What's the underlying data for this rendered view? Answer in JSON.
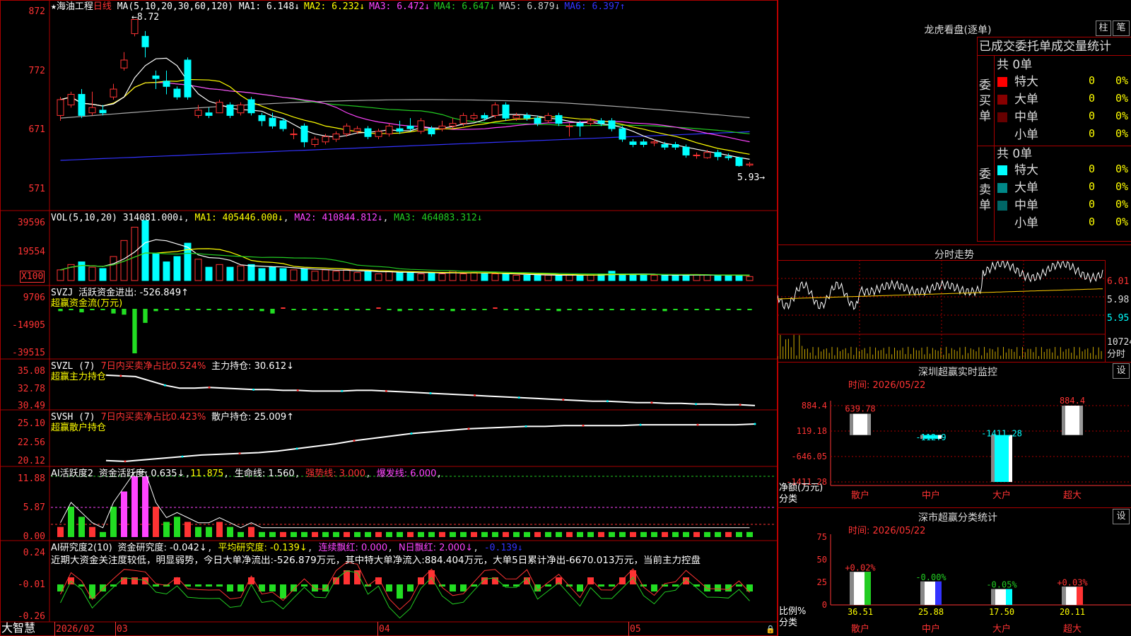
{
  "colors": {
    "up": "#ff3333",
    "down": "#00ffff",
    "grid": "#aa0000",
    "white": "#ffffff",
    "yellow": "#ffff00",
    "magenta": "#ff44ff",
    "green": "#22cc22",
    "gray": "#aaaaaa",
    "blue": "#3333ff",
    "gold": "#ffcc00"
  },
  "app": {
    "logo": "大智慧",
    "stock_name": "海油工程",
    "period": "日线",
    "star": "★"
  },
  "price_panel": {
    "ma_title": "MA(5,10,20,30,60,120)",
    "ma": [
      {
        "label": "MA1: 6.148↓",
        "color": "#ffffff"
      },
      {
        "label": "MA2: 6.232↓",
        "color": "#ffff00"
      },
      {
        "label": "MA3: 6.472↓",
        "color": "#ff44ff"
      },
      {
        "label": "MA4: 6.647↓",
        "color": "#22cc22"
      },
      {
        "label": "MA5: 6.879↓",
        "color": "#cccccc"
      },
      {
        "label": "MA6: 6.397↑",
        "color": "#3333ff"
      }
    ],
    "yticks": [
      "872",
      "772",
      "671",
      "571"
    ],
    "high_mark": "8.72",
    "low_mark": "5.93→"
  },
  "vol_panel": {
    "title": "VOL(5,10,20)",
    "value": "314081.000↓",
    "ma1": "MA1: 405446.000↓",
    "ma2": "MA2: 410844.812↓",
    "ma3": "MA3: 464083.312↓",
    "yticks": [
      "39596",
      "19554"
    ],
    "unit": "X100"
  },
  "svzj_panel": {
    "title": "SVZJ",
    "label": "活跃资金进出: -526.849↑",
    "subtitle": "超赢资金流(万元)",
    "yticks": [
      "9706",
      "-14905",
      "-39515"
    ]
  },
  "svzl_panel": {
    "title": "SVZL (7)",
    "net": "7日内买卖净占比0.524%",
    "hold": "主力持仓: 30.612↓",
    "subtitle": "超赢主力持仓",
    "yticks": [
      "35.08",
      "32.78",
      "30.49"
    ]
  },
  "svsh_panel": {
    "title": "SVSH (7)",
    "net": "7日内买卖净占比0.423%",
    "hold": "散户持仓: 25.009↑",
    "subtitle": "超赢散户持仓",
    "yticks": [
      "25.10",
      "22.56",
      "20.12"
    ]
  },
  "ai_active_panel": {
    "title": "AI活跃度2",
    "a": "资金活跃度: 0.635↓",
    "b": "11.875",
    "c": "生命线: 1.560",
    "d": "强势线: 3.000",
    "e": "爆发线: 6.000",
    "yticks": [
      "11.88",
      "5.87",
      "0.00"
    ]
  },
  "ai_research_panel": {
    "title": "AI研究度2(10)",
    "a": "资金研究度: -0.042↓",
    "b": "平均研究度: -0.139↓",
    "c": "连续飘红: 0.000",
    "d": "N日飘红: 2.000↓",
    "e": "-0.139↓",
    "comment": "近期大资金关注度较低，明显弱势，今日大单净流出:-526.879万元，其中特大单净流入:884.404万元，大单5日累计净出-6670.013万元，当前主力控盘",
    "yticks": [
      "0.24",
      "-0.01",
      "-0.26"
    ]
  },
  "date_axis": {
    "labels": [
      "2026/02",
      "03",
      "04",
      "05"
    ]
  },
  "lhb": {
    "title": "龙虎看盘(逐单)",
    "btn_zhu": "柱",
    "btn_bi": "笔",
    "header": "已成交委托单成交量统计",
    "buy_label": "委买单",
    "sell_label": "委卖单",
    "buy_total": "共 0单",
    "sell_total": "共 0单",
    "buy_rows": [
      {
        "name": "特大",
        "count": "0",
        "pct": "0%",
        "color": "#ff0000"
      },
      {
        "name": "大单",
        "count": "0",
        "pct": "0%",
        "color": "#880000"
      },
      {
        "name": "中单",
        "count": "0",
        "pct": "0%",
        "color": "#660000"
      },
      {
        "name": "小单",
        "count": "0",
        "pct": "0%",
        "color": ""
      }
    ],
    "sell_rows": [
      {
        "name": "特大",
        "count": "0",
        "pct": "0%",
        "color": "#00ffff"
      },
      {
        "name": "大单",
        "count": "0",
        "pct": "0%",
        "color": "#008888"
      },
      {
        "name": "中单",
        "count": "0",
        "pct": "0%",
        "color": "#006666"
      },
      {
        "name": "小单",
        "count": "0",
        "pct": "0%",
        "color": ""
      }
    ]
  },
  "intraday": {
    "title": "分时走势",
    "yticks": [
      "6.01",
      "5.98",
      "5.95"
    ],
    "vol_label": "10724",
    "vol_unit": "分时"
  },
  "sz_monitor": {
    "title": "深圳超赢实时监控",
    "btn": "设",
    "time": "时间: 2026/05/22",
    "yticks": [
      "884.4",
      "119.18",
      "-646.05",
      "-1411.28"
    ],
    "axis_label": "净额(万元)",
    "cat_label": "分类",
    "categories": [
      "散户",
      "中户",
      "大户",
      "超大"
    ],
    "values": [
      639.78,
      -112.9,
      -1411.28,
      884.4
    ],
    "value_labels": [
      "639.78",
      "-112.9",
      "-1411.28",
      "884.4"
    ]
  },
  "sz_class": {
    "title": "深市超赢分类统计",
    "btn": "设",
    "time": "时间: 2026/05/22",
    "yticks": [
      "75",
      "50",
      "25",
      "0"
    ],
    "axis_label": "比例%",
    "cat_label": "分类",
    "categories": [
      "散户",
      "中户",
      "大户",
      "超大"
    ],
    "values": [
      36.51,
      25.88,
      17.5,
      20.11
    ],
    "value_labels": [
      "36.51",
      "25.88",
      "17.50",
      "20.11"
    ],
    "change_labels": [
      "+0.02%",
      "-0.00%",
      "-0.05%",
      "+0.03%"
    ]
  },
  "chart_data": [
    {
      "type": "candlestick",
      "title": "海油工程 日线",
      "ylim": [
        5.5,
        8.9
      ],
      "candles": [
        [
          6.9,
          7.2,
          6.8,
          7.25
        ],
        [
          7.1,
          7.3,
          7.05,
          7.35
        ],
        [
          7.3,
          6.9,
          6.85,
          7.4
        ],
        [
          6.95,
          7.05,
          6.9,
          7.35
        ],
        [
          7.0,
          6.95,
          6.9,
          7.1
        ],
        [
          7.25,
          7.4,
          7.2,
          7.5
        ],
        [
          7.8,
          7.95,
          7.75,
          8.1
        ],
        [
          8.45,
          8.72,
          8.4,
          8.72
        ],
        [
          8.4,
          8.2,
          8.0,
          8.5
        ],
        [
          7.65,
          7.6,
          7.4,
          7.75
        ],
        [
          7.55,
          7.45,
          7.3,
          7.75
        ],
        [
          7.4,
          7.25,
          7.2,
          7.45
        ],
        [
          7.95,
          7.25,
          7.2,
          8.0
        ],
        [
          6.9,
          7.0,
          6.85,
          7.1
        ],
        [
          6.95,
          6.9,
          6.85,
          7.05
        ],
        [
          6.95,
          7.15,
          6.95,
          7.2
        ],
        [
          7.1,
          6.9,
          6.85,
          7.15
        ],
        [
          6.95,
          7.1,
          6.9,
          7.15
        ],
        [
          7.2,
          6.95,
          6.9,
          7.25
        ],
        [
          6.9,
          6.8,
          6.7,
          6.95
        ],
        [
          6.85,
          6.7,
          6.65,
          6.95
        ],
        [
          6.8,
          6.65,
          6.6,
          6.85
        ],
        [
          6.55,
          6.55,
          6.45,
          6.65
        ],
        [
          6.7,
          6.4,
          6.3,
          6.75
        ],
        [
          6.35,
          6.45,
          6.3,
          6.5
        ],
        [
          6.4,
          6.5,
          6.35,
          6.55
        ],
        [
          6.45,
          6.55,
          6.4,
          6.6
        ],
        [
          6.55,
          6.7,
          6.5,
          6.75
        ],
        [
          6.6,
          6.65,
          6.55,
          6.7
        ],
        [
          6.65,
          6.5,
          6.45,
          6.7
        ],
        [
          6.5,
          6.6,
          6.45,
          6.65
        ],
        [
          6.55,
          6.7,
          6.5,
          6.75
        ],
        [
          6.65,
          6.6,
          6.55,
          6.8
        ],
        [
          6.7,
          6.65,
          6.6,
          6.85
        ],
        [
          6.6,
          6.8,
          6.55,
          6.85
        ],
        [
          6.65,
          6.55,
          6.5,
          6.7
        ],
        [
          6.65,
          6.7,
          6.6,
          6.8
        ],
        [
          6.7,
          6.75,
          6.65,
          6.85
        ],
        [
          6.75,
          6.9,
          6.7,
          6.95
        ],
        [
          6.85,
          6.9,
          6.8,
          6.95
        ],
        [
          6.9,
          6.85,
          6.8,
          6.95
        ],
        [
          6.9,
          7.1,
          6.85,
          7.15
        ],
        [
          7.1,
          6.85,
          6.8,
          7.15
        ],
        [
          6.85,
          6.9,
          6.8,
          6.95
        ],
        [
          6.9,
          6.85,
          6.8,
          6.95
        ],
        [
          6.85,
          6.75,
          6.7,
          6.9
        ],
        [
          6.8,
          6.9,
          6.75,
          6.95
        ],
        [
          6.9,
          6.75,
          6.7,
          6.95
        ],
        [
          6.7,
          6.7,
          6.5,
          6.75
        ],
        [
          6.75,
          6.7,
          6.5,
          6.8
        ],
        [
          6.75,
          6.8,
          6.7,
          6.85
        ],
        [
          6.8,
          6.75,
          6.7,
          6.85
        ],
        [
          6.8,
          6.65,
          6.6,
          6.85
        ],
        [
          6.65,
          6.45,
          6.4,
          6.7
        ],
        [
          6.4,
          6.35,
          6.3,
          6.45
        ],
        [
          6.4,
          6.35,
          6.3,
          6.45
        ],
        [
          6.38,
          6.4,
          6.32,
          6.45
        ],
        [
          6.35,
          6.3,
          6.25,
          6.4
        ],
        [
          6.35,
          6.3,
          6.25,
          6.4
        ],
        [
          6.3,
          6.15,
          6.1,
          6.35
        ],
        [
          6.15,
          6.15,
          6.08,
          6.2
        ],
        [
          6.1,
          6.2,
          6.08,
          6.25
        ],
        [
          6.2,
          6.12,
          6.05,
          6.25
        ],
        [
          6.12,
          6.1,
          6.05,
          6.18
        ],
        [
          6.1,
          5.95,
          5.93,
          6.12
        ],
        [
          5.96,
          5.98,
          5.93,
          6.02
        ]
      ]
    },
    {
      "type": "bar",
      "title": "VOL(5,10,20)",
      "ylim": [
        0,
        45000
      ],
      "values": [
        8,
        12,
        14,
        10,
        9,
        18,
        30,
        40,
        45,
        20,
        14,
        18,
        28,
        16,
        10,
        12,
        10,
        11,
        12,
        9,
        10,
        9,
        8,
        9,
        7,
        8,
        7,
        8,
        6,
        7,
        5,
        7,
        6,
        6,
        5,
        6,
        5,
        7,
        5,
        6,
        5,
        5,
        5,
        4,
        4,
        4,
        4,
        4,
        4,
        4,
        4,
        5,
        7,
        5,
        4,
        4,
        4,
        4,
        4,
        4,
        4,
        4,
        4,
        4,
        4,
        3
      ]
    },
    {
      "type": "bar",
      "title": "超赢资金流(万元)",
      "ylim": [
        -39515,
        9706
      ],
      "values": [
        -2,
        0,
        -3,
        0,
        0,
        -4,
        -5,
        -38,
        -12,
        -2,
        -1,
        -1,
        -1,
        0,
        0,
        -1,
        -1,
        -1,
        -1,
        -2,
        -4,
        1,
        0,
        -1,
        0,
        -1,
        0,
        0,
        -1,
        0,
        1,
        0,
        -2,
        0,
        0,
        0,
        0,
        -2,
        0,
        -1,
        0,
        1,
        0,
        0,
        -1,
        0,
        0,
        -2,
        0,
        -1,
        0,
        0,
        0,
        -1,
        0,
        0,
        -1,
        -2,
        0,
        -1,
        0,
        -1,
        0,
        -1,
        -1,
        -1
      ]
    },
    {
      "type": "line",
      "title": "超赢主力持仓",
      "ylim": [
        30.49,
        35.08
      ],
      "values": [
        34.8,
        34.7,
        34.6,
        34.0,
        33.4,
        33.0,
        33.0,
        33.1,
        33.0,
        32.9,
        32.8,
        32.8,
        32.7,
        32.7,
        32.6,
        32.6,
        32.6,
        32.7,
        32.7,
        32.6,
        32.5,
        32.4,
        32.3,
        32.2,
        32.1,
        32.0,
        31.9,
        31.8,
        31.7,
        31.6,
        31.5,
        31.4,
        31.3,
        31.2,
        31.2,
        31.1,
        31.0,
        31.0,
        30.9,
        30.9,
        30.8,
        30.8,
        30.7,
        30.7,
        30.6
      ]
    },
    {
      "type": "line",
      "title": "超赢散户持仓",
      "ylim": [
        20.12,
        25.1
      ],
      "values": [
        20.5,
        20.4,
        20.6,
        20.8,
        21.0,
        21.2,
        21.3,
        21.4,
        21.5,
        21.7,
        22.0,
        22.3,
        22.6,
        23.0,
        23.3,
        23.6,
        23.9,
        24.1,
        24.3,
        24.5,
        24.6,
        24.7,
        24.8,
        24.8,
        24.9,
        24.9,
        24.9,
        24.9,
        25.0,
        25.0,
        25.0,
        25.0,
        25.0,
        25.0,
        25.1
      ]
    }
  ]
}
